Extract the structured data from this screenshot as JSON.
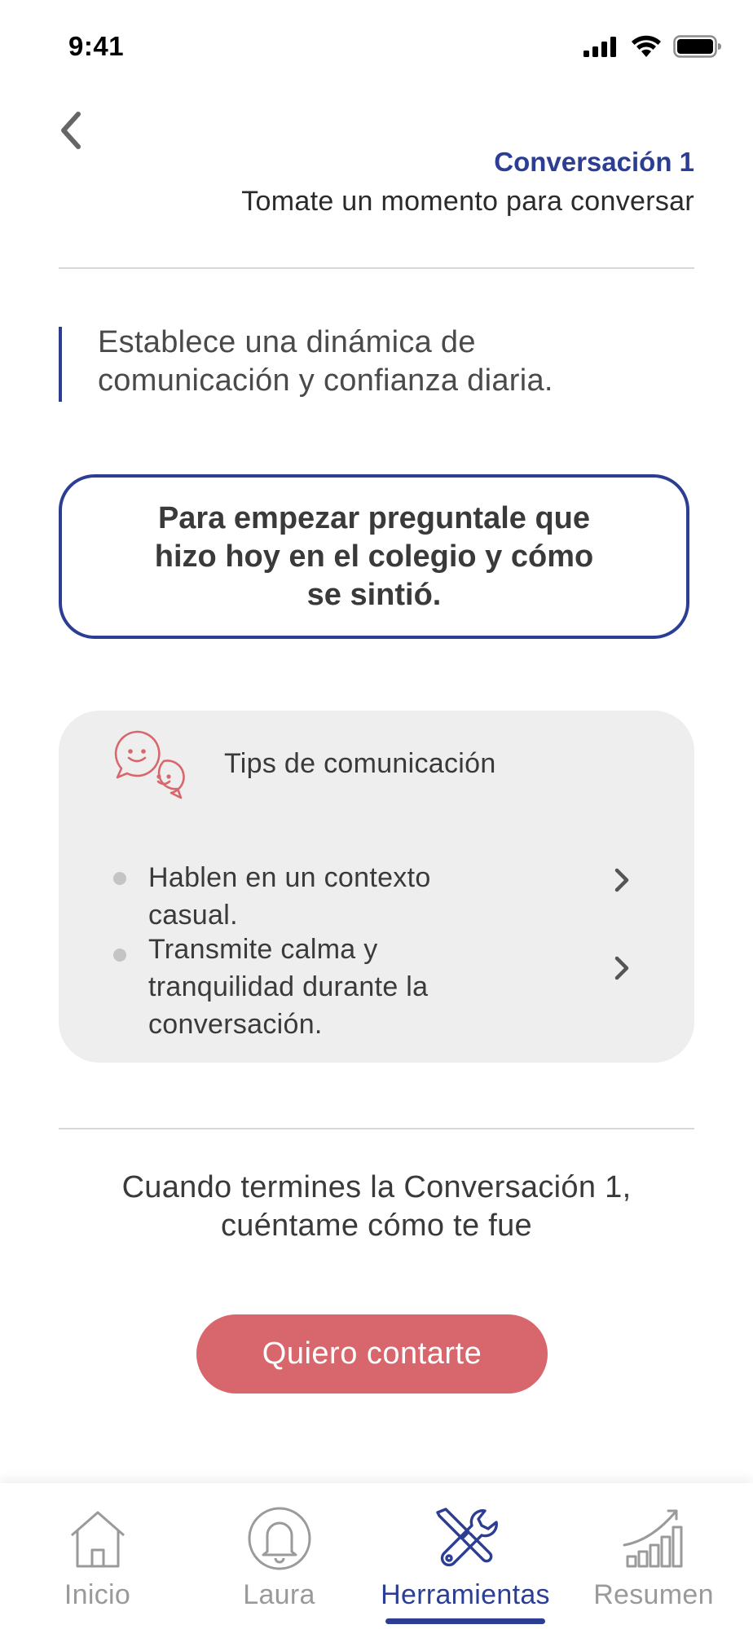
{
  "status_bar": {
    "time": "9:41"
  },
  "header": {
    "title": "Conversación 1",
    "subtitle": "Tomate un momento para conversar"
  },
  "quote": {
    "text": "Establece una dinámica de comunicación y confianza diaria."
  },
  "prompt": {
    "text": "Para empezar preguntale que hizo hoy en el colegio y cómo se sintió."
  },
  "tips": {
    "title": "Tips de comunicación",
    "items": [
      {
        "text": "Hablen en un contexto casual."
      },
      {
        "text": "Transmite calma y tranquilidad durante la conversación."
      }
    ]
  },
  "closing": {
    "text": "Cuando termines la Conversación 1, cuéntame cómo te fue",
    "button_label": "Quiero contarte"
  },
  "tab_bar": {
    "tabs": [
      {
        "label": "Inicio",
        "icon": "home-icon",
        "active": false
      },
      {
        "label": "Laura",
        "icon": "bell-icon",
        "active": false
      },
      {
        "label": "Herramientas",
        "icon": "tools-icon",
        "active": true
      },
      {
        "label": "Resumen",
        "icon": "chart-icon",
        "active": false
      }
    ]
  },
  "colors": {
    "primary": "#2c3e94",
    "accent": "#d8676d",
    "card_bg": "#eeeeee",
    "inactive": "#9a9a9a"
  }
}
